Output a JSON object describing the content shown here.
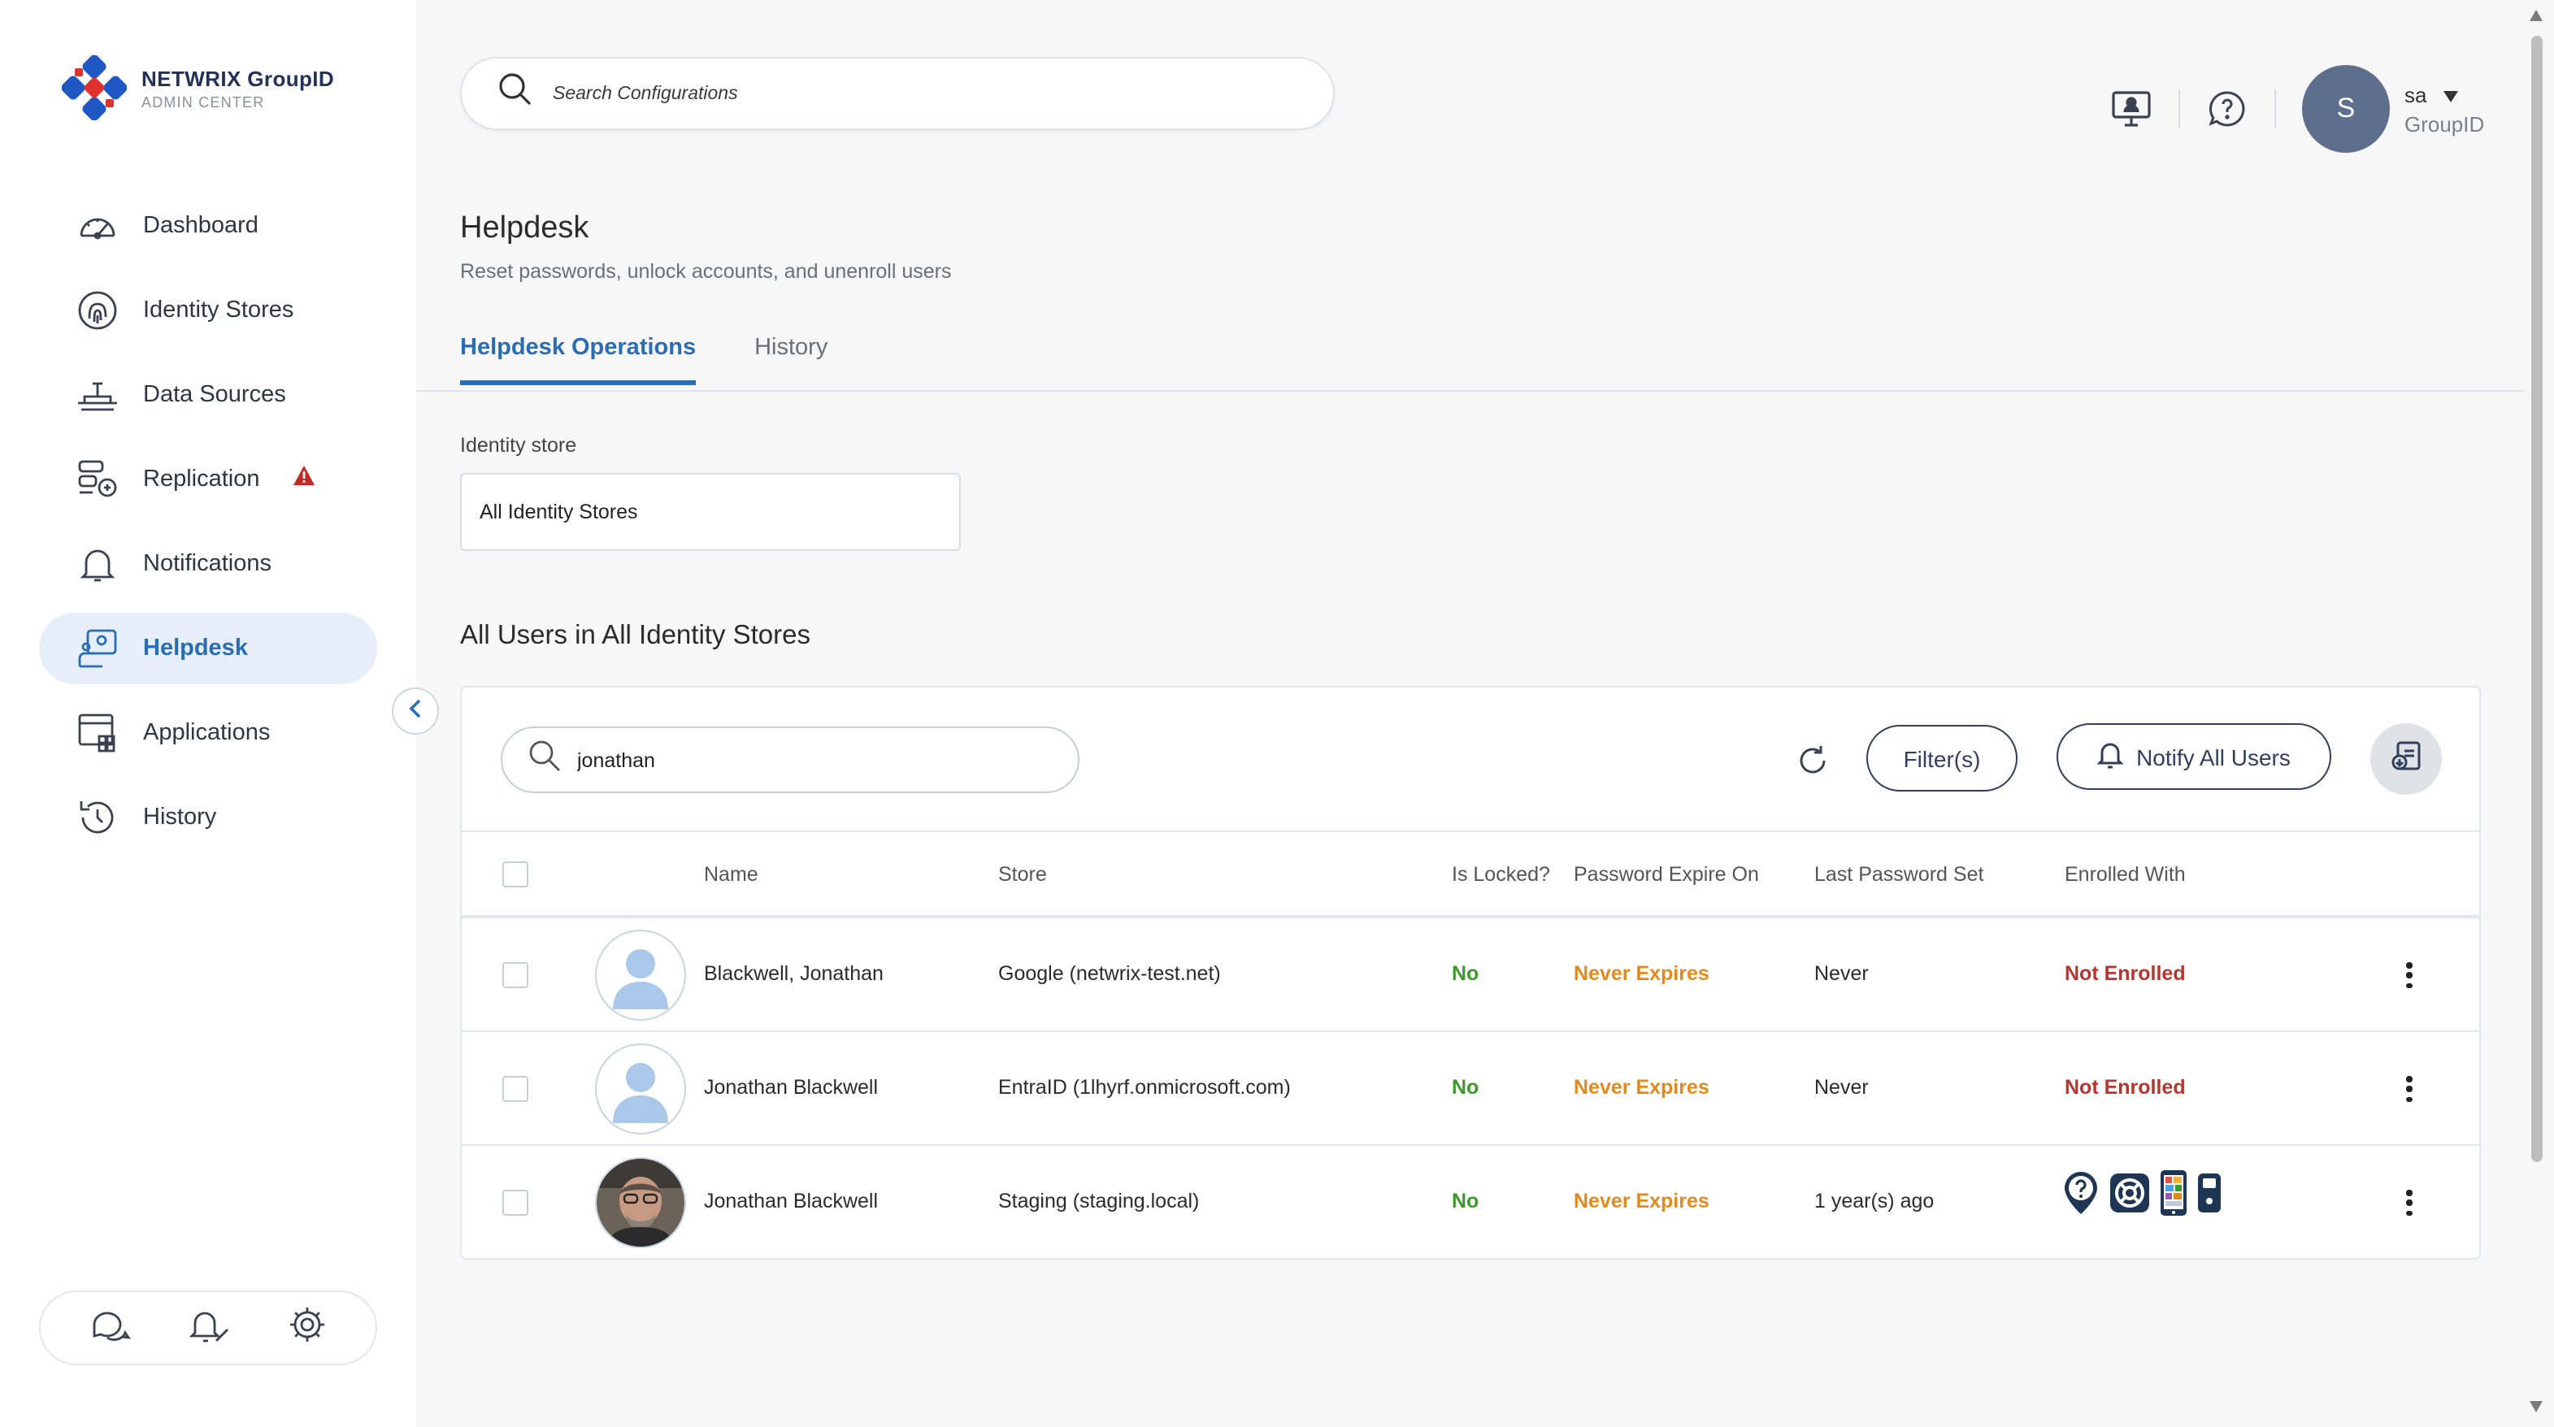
{
  "brand": {
    "name": "NETWRIX GroupID",
    "sub": "ADMIN CENTER"
  },
  "sidebar": {
    "items": [
      {
        "label": "Dashboard",
        "icon": "dashboard-gauge-icon"
      },
      {
        "label": "Identity Stores",
        "icon": "fingerprint-icon"
      },
      {
        "label": "Data Sources",
        "icon": "data-sources-icon"
      },
      {
        "label": "Replication",
        "icon": "replication-icon",
        "warning": true
      },
      {
        "label": "Notifications",
        "icon": "bell-icon"
      },
      {
        "label": "Helpdesk",
        "icon": "helpdesk-icon",
        "active": true
      },
      {
        "label": "Applications",
        "icon": "applications-icon"
      },
      {
        "label": "History",
        "icon": "history-icon"
      }
    ]
  },
  "header": {
    "search_placeholder": "Search Configurations",
    "user_name": "sa",
    "user_initial": "S",
    "user_org": "GroupID"
  },
  "page": {
    "title": "Helpdesk",
    "subtitle": "Reset passwords, unlock accounts, and unenroll users",
    "tabs": [
      "Helpdesk Operations",
      "History"
    ],
    "identity_store_label": "Identity store",
    "identity_store_value": "All Identity Stores",
    "section_title": "All Users in All Identity Stores"
  },
  "toolbar": {
    "search_value": "jonathan",
    "filter_label": "Filter(s)",
    "notify_label": "Notify All Users"
  },
  "table": {
    "columns": [
      "Name",
      "Store",
      "Is Locked?",
      "Password Expire On",
      "Last Password Set",
      "Enrolled With"
    ],
    "rows": [
      {
        "name": "Blackwell, Jonathan",
        "store": "Google (netwrix-test.net)",
        "locked": "No",
        "expire": "Never Expires",
        "last_set": "Never",
        "enrolled": "Not Enrolled",
        "photo": false
      },
      {
        "name": "Jonathan Blackwell",
        "store": "EntraID (1lhyrf.onmicrosoft.com)",
        "locked": "No",
        "expire": "Never Expires",
        "last_set": "Never",
        "enrolled": "Not Enrolled",
        "photo": false
      },
      {
        "name": "Jonathan Blackwell",
        "store": "Staging (staging.local)",
        "locked": "No",
        "expire": "Never Expires",
        "last_set": "1 year(s) ago",
        "enrolled": "",
        "photo": true,
        "enroll_icons": [
          "security-question-icon",
          "lifebuoy-icon",
          "mobile-app-icon",
          "hardware-token-icon"
        ]
      }
    ]
  },
  "colors": {
    "accent": "#2a6db5",
    "no": "#3c9a2a",
    "never_expires": "#e38a1e",
    "not_enrolled": "#b6352f",
    "warning": "#c62828"
  }
}
